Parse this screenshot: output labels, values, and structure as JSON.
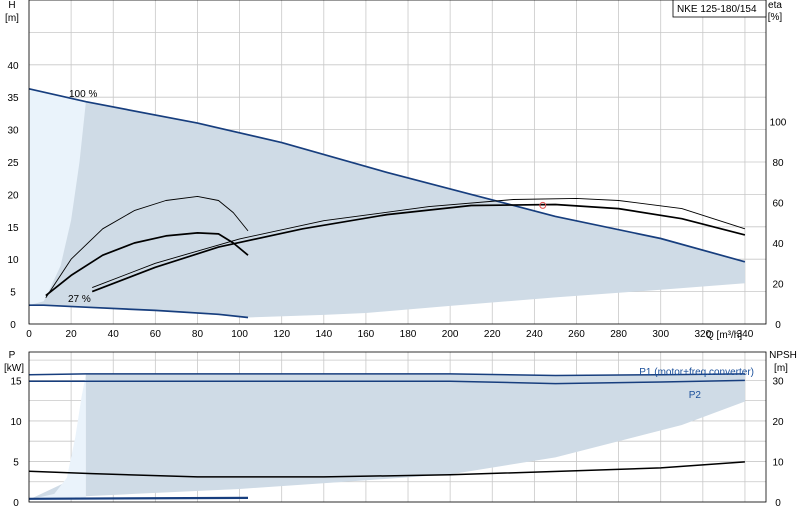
{
  "chart_data": [
    {
      "type": "line",
      "title": "NKE 125-180/154",
      "xlabel": "Q [m³/h]",
      "ylabel_left": "H [m]",
      "ylabel_right": "eta [%]",
      "xlim": [
        0,
        350
      ],
      "ylim_left": [
        0,
        50
      ],
      "ylim_right": [
        0,
        160
      ],
      "x_ticks": [
        0,
        20,
        40,
        60,
        80,
        100,
        120,
        140,
        160,
        180,
        200,
        220,
        240,
        260,
        280,
        300,
        320,
        340
      ],
      "y_ticks_left": [
        0,
        5,
        10,
        15,
        20,
        25,
        30,
        35,
        40
      ],
      "y_ticks_right": [
        0,
        20,
        40,
        60,
        80,
        100
      ],
      "grid": true,
      "labels": [
        "100 %",
        "27 %"
      ],
      "colors": {
        "range_fill": "#cfdbe6",
        "min_fill": "#eaf3fb",
        "curve_blue": "#173e7e",
        "curve_black": "#000000",
        "duty_marker": "#e05050"
      },
      "range_upper": {
        "x": [
          0,
          27,
          80,
          120,
          170,
          210,
          250,
          300,
          340
        ],
        "y": [
          36.3,
          34.3,
          31,
          28,
          23.4,
          20,
          16.6,
          13.2,
          9.6
        ]
      },
      "range_lower": {
        "x": [
          340,
          300,
          250,
          200,
          160,
          140,
          104
        ],
        "y": [
          6.3,
          5.3,
          4.1,
          2.8,
          1.7,
          1.4,
          1.0
        ]
      },
      "min_region": {
        "x": [
          0,
          27,
          24,
          20,
          15,
          10,
          7,
          0
        ],
        "y": [
          36.3,
          34.3,
          25,
          16,
          9,
          5.5,
          3.5,
          2.9
        ]
      },
      "series": [
        {
          "role": "head-max",
          "x": [
            0,
            27,
            80,
            120,
            170,
            210,
            250,
            300,
            340
          ],
          "y": [
            36.3,
            34.3,
            31,
            28,
            23.4,
            20,
            16.6,
            13.2,
            9.6
          ]
        },
        {
          "role": "head-min",
          "x": [
            0,
            7,
            27,
            60,
            90,
            104
          ],
          "y": [
            2.9,
            2.9,
            2.6,
            2.1,
            1.5,
            1.0
          ]
        },
        {
          "role": "efficiency-100",
          "x": [
            30,
            60,
            90,
            130,
            170,
            210,
            250,
            280,
            310,
            340
          ],
          "y": [
            16,
            28,
            38,
            47,
            54,
            58.5,
            59,
            57,
            52,
            44
          ]
        },
        {
          "role": "efficiency-27",
          "x": [
            8,
            20,
            35,
            50,
            65,
            80,
            90,
            97,
            104
          ],
          "y": [
            14,
            24,
            34,
            40,
            43.5,
            45,
            44.5,
            40,
            34
          ]
        },
        {
          "role": "efficiency-thin-100",
          "x": [
            30,
            60,
            100,
            140,
            190,
            230,
            260,
            280,
            310,
            340
          ],
          "y": [
            18,
            30,
            42,
            51,
            58,
            61.5,
            62,
            61,
            57,
            47
          ]
        },
        {
          "role": "efficiency-thin-27",
          "x": [
            8,
            20,
            35,
            50,
            65,
            80,
            90,
            97,
            104
          ],
          "y": [
            13,
            32,
            47,
            56,
            61,
            63,
            61,
            55,
            46
          ]
        }
      ],
      "duty_point": {
        "x": 244,
        "y": 18.3
      }
    },
    {
      "type": "line",
      "xlabel": "",
      "ylabel_left": "P [kW]",
      "ylabel_right": "NPSH [m]",
      "xlim": [
        0,
        350
      ],
      "ylim_left": [
        0,
        18.5
      ],
      "ylim_right": [
        0,
        37
      ],
      "y_ticks_left": [
        0,
        5,
        10,
        15
      ],
      "y_ticks_right": [
        0,
        10,
        20,
        30
      ],
      "grid": true,
      "legend": [
        "P1 (motor+freq.converter)",
        "P2"
      ],
      "power_fill": {
        "x": [
          0,
          18,
          22,
          25,
          27,
          100,
          200,
          250,
          300,
          340,
          340,
          310,
          250,
          200,
          150,
          100,
          50,
          10,
          0
        ],
        "y": [
          0.3,
          2.5,
          7,
          12,
          15.8,
          15.8,
          15.8,
          15.6,
          15.7,
          15.8,
          12.4,
          9.5,
          5.5,
          3.4,
          2.5,
          1.6,
          1.0,
          0.5,
          0.3
        ]
      },
      "series": [
        {
          "name": "P1 (motor+freq.converter)",
          "x": [
            0,
            27,
            100,
            200,
            250,
            300,
            340
          ],
          "y": [
            15.7,
            15.8,
            15.8,
            15.8,
            15.6,
            15.7,
            15.8
          ]
        },
        {
          "name": "P2",
          "x": [
            0,
            27,
            100,
            200,
            250,
            300,
            340
          ],
          "y": [
            14.9,
            14.9,
            14.9,
            14.9,
            14.6,
            14.8,
            15.0
          ]
        },
        {
          "role": "npsh",
          "x": [
            0,
            30,
            80,
            140,
            200,
            260,
            300,
            340
          ],
          "y": [
            7.6,
            7.0,
            6.2,
            6.2,
            6.7,
            7.7,
            8.4,
            9.9
          ]
        },
        {
          "role": "p-min-27",
          "x": [
            0,
            104
          ],
          "y": [
            0.4,
            0.5
          ]
        }
      ]
    }
  ]
}
